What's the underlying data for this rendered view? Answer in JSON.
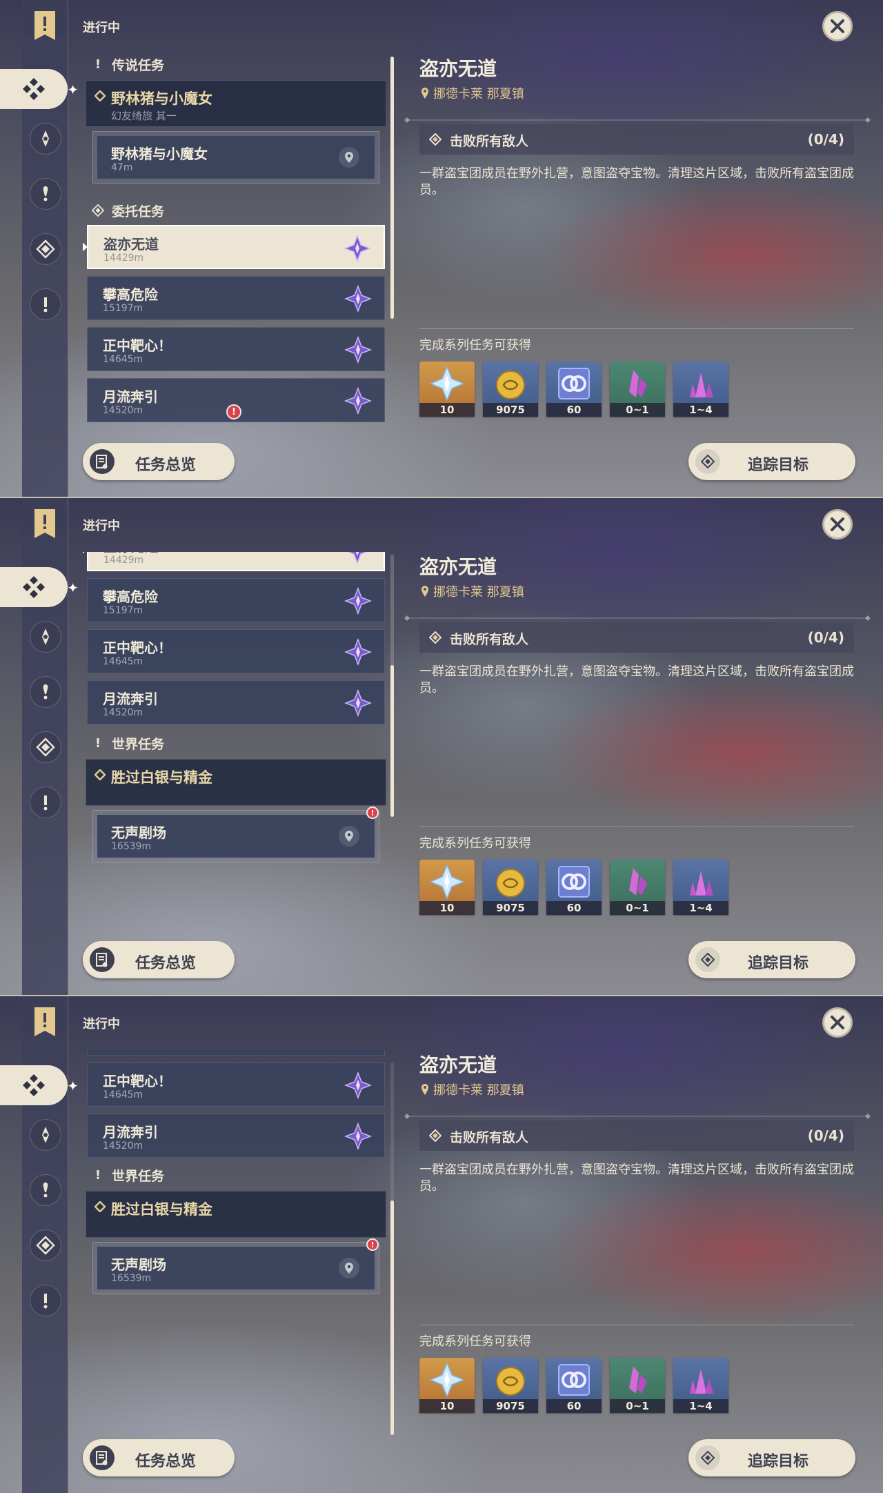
{
  "header": {
    "in_progress": "进行中"
  },
  "sections": {
    "legend": "传说任务",
    "commission": "委托任务",
    "world": "世界任务"
  },
  "quests": {
    "legend_parent": {
      "title": "野林猪与小魔女",
      "subtitle": "幻友绮旅 其一"
    },
    "legend_child": {
      "title": "野林猪与小魔女",
      "distance": "47m"
    },
    "c1": {
      "title": "盗亦无道",
      "distance": "14429m"
    },
    "c2": {
      "title": "攀高危险",
      "distance": "15197m"
    },
    "c3": {
      "title": "正中靶心！",
      "distance": "14645m"
    },
    "c4": {
      "title": "月流奔引",
      "distance": "14520m"
    },
    "world_parent": {
      "title": "胜过白银与精金"
    },
    "world_child": {
      "title": "无声剧场",
      "distance": "16539m"
    },
    "c2_partial_distance": "15197m"
  },
  "alert_mark": "!",
  "detail": {
    "title": "盗亦无道",
    "location": "挪德卡莱 那夏镇",
    "objective": "击败所有敌人",
    "objective_count": "(0/4)",
    "description": "一群盗宝团成员在野外扎营，意图盗夺宝物。清理这片区域，击败所有盗宝团成员。",
    "rewards_label": "完成系列任务可获得",
    "rewards": [
      {
        "icon": "primogem-icon",
        "count": "10"
      },
      {
        "icon": "mora-icon",
        "count": "9075"
      },
      {
        "icon": "fate-icon",
        "count": "60"
      },
      {
        "icon": "crystal-icon",
        "count": "0~1"
      },
      {
        "icon": "crystal-cluster-icon",
        "count": "1~4"
      }
    ]
  },
  "buttons": {
    "overview": "任务总览",
    "track": "追踪目标"
  },
  "colors": {
    "accent": "#ece5d3",
    "gold": "#e3c98d",
    "panel": "#3a425c",
    "alert": "#d9434b",
    "star": "#7a5cc8"
  }
}
